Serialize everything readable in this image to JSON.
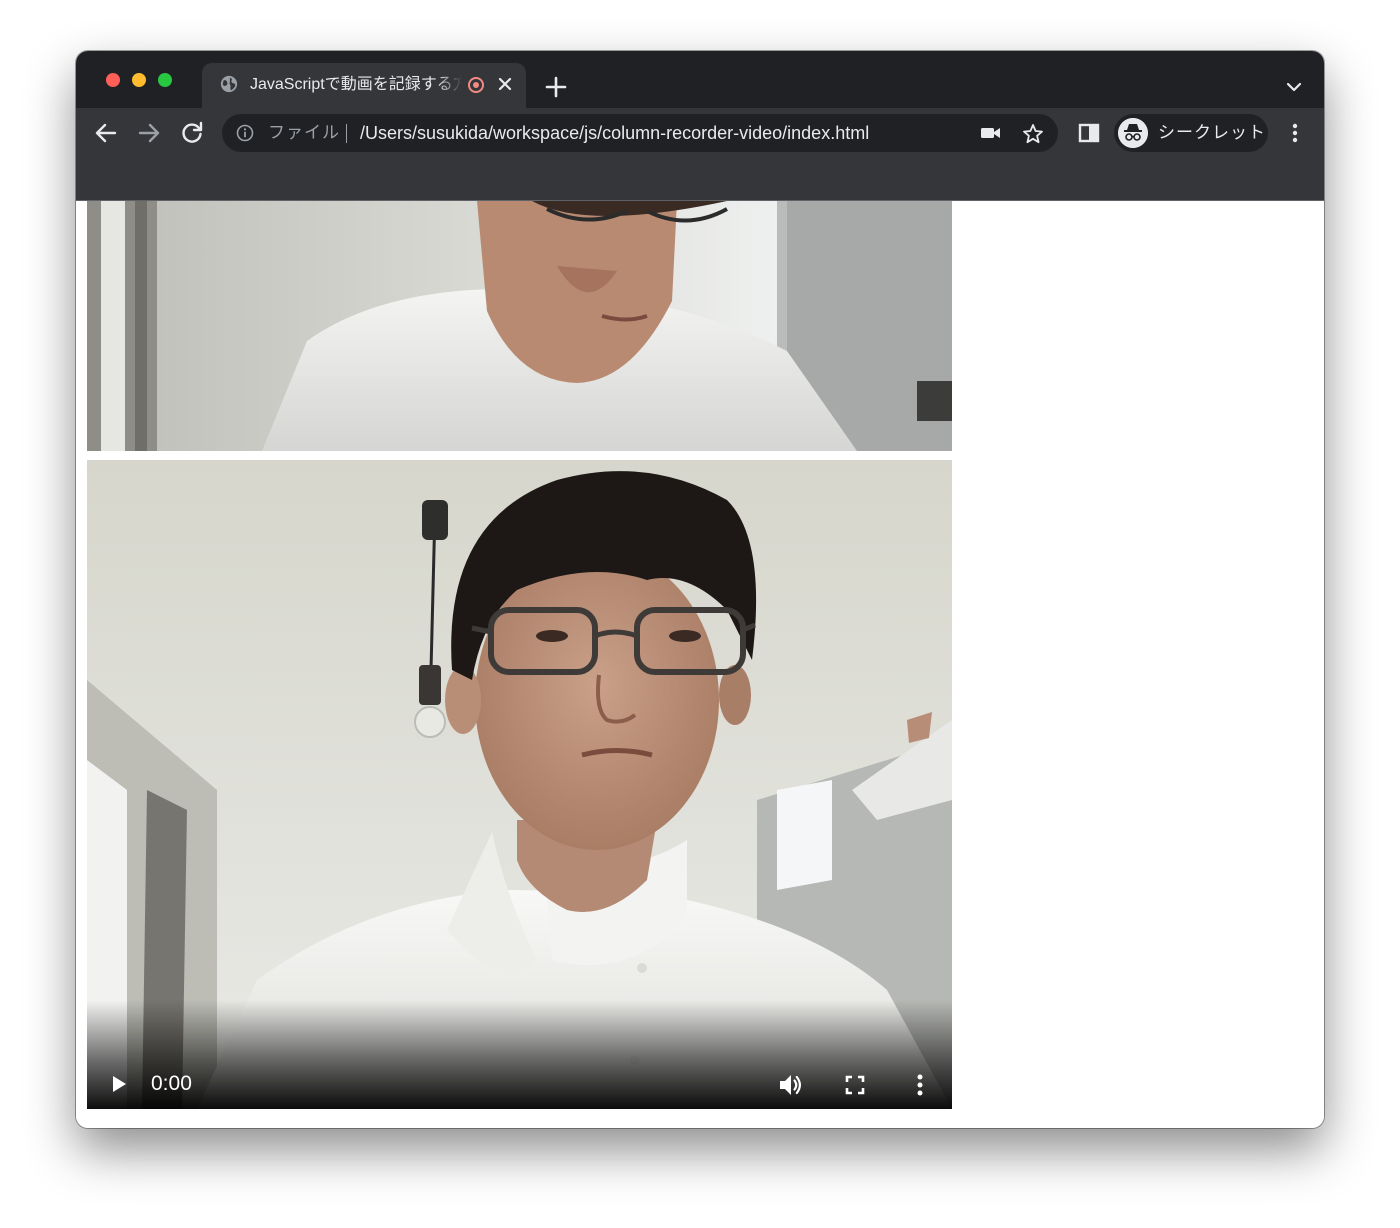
{
  "browser": {
    "tab": {
      "title": "JavaScriptで動画を記録する方",
      "favicon": "globe-icon",
      "recording_indicator": "recording-icon",
      "close_icon": "close-icon"
    },
    "new_tab_icon": "plus-icon",
    "tab_search_icon": "chevron-down-icon",
    "toolbar": {
      "back_icon": "arrow-left-icon",
      "forward_icon": "arrow-right-icon",
      "reload_icon": "reload-icon"
    },
    "omnibox": {
      "info_icon": "info-icon",
      "scheme_label": "ファイル",
      "url": "/Users/susukida/workspace/js/column-recorder-video/index.html",
      "camera_icon": "video-camera-icon",
      "bookmark_icon": "star-icon"
    },
    "side_panel_icon": "side-panel-icon",
    "profile": {
      "label": "シークレット",
      "icon": "incognito-icon"
    },
    "menu_icon": "kebab-menu-icon"
  },
  "page": {
    "preview_video": {
      "name": "live-camera-preview"
    },
    "recorded_video": {
      "name": "recorded-video",
      "time": "0:00",
      "progress": 0,
      "controls": {
        "play_icon": "play-icon",
        "volume_icon": "volume-icon",
        "fullscreen_icon": "fullscreen-icon",
        "more_icon": "more-vertical-icon"
      }
    }
  },
  "colors": {
    "tabstrip": "#202124",
    "toolbar": "#35363a",
    "text": "#e8eaed",
    "muted_text": "#9aa0a6",
    "recording": "#f28b82"
  }
}
